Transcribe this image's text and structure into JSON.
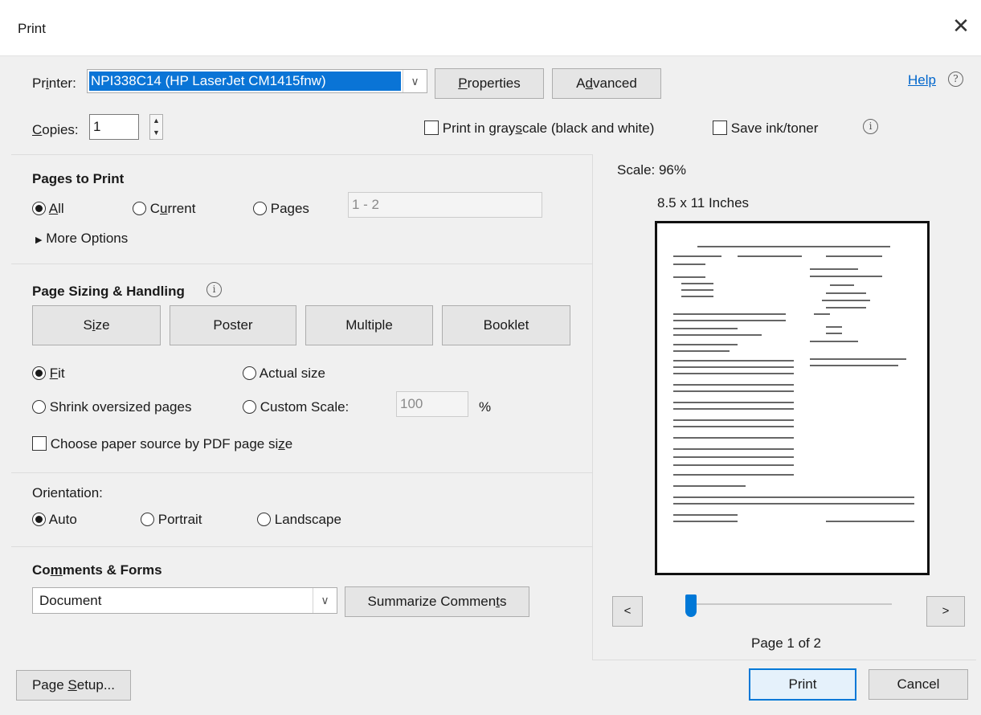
{
  "window": {
    "title": "Print"
  },
  "printer": {
    "label_pre": "Pr",
    "label_u": "i",
    "label_post": "nter:",
    "selected": "NPI338C14 (HP LaserJet CM1415fnw)",
    "properties_pre": "",
    "properties_u": "P",
    "properties_post": "roperties",
    "advanced_pre": "A",
    "advanced_u": "d",
    "advanced_post": "vanced",
    "help": "Help"
  },
  "copies": {
    "label_u": "C",
    "label_post": "opies:",
    "value": "1",
    "grayscale_pre": "Print in gray",
    "grayscale_u": "s",
    "grayscale_post": "cale (black and white)",
    "save_ink": "Save ink/toner"
  },
  "pages_to_print": {
    "title": "Pages to Print",
    "all_u": "A",
    "all_post": "ll",
    "current_pre": "C",
    "current_u": "u",
    "current_post": "rrent",
    "pages": "Pages",
    "range_value": "1 - 2",
    "more_options": "More Options"
  },
  "sizing": {
    "title": "Page Sizing & Handling",
    "size_pre": "S",
    "size_u": "i",
    "size_post": "ze",
    "poster": "Poster",
    "multiple": "Multiple",
    "booklet": "Booklet",
    "fit_u": "F",
    "fit_post": "it",
    "actual_size": "Actual size",
    "shrink": "Shrink oversized pages",
    "custom_scale": "Custom Scale:",
    "scale_value": "100",
    "percent": "%",
    "paper_source_pre": "Choose paper source by PDF page si",
    "paper_source_u": "z",
    "paper_source_post": "e"
  },
  "orientation": {
    "title": "Orientation:",
    "auto": "Auto",
    "portrait": "Portrait",
    "landscape": "Landscape"
  },
  "comments_forms": {
    "title_pre": "Co",
    "title_u": "m",
    "title_post": "ments & Forms",
    "selected": "Document",
    "summarize_pre": "Summarize Commen",
    "summarize_u": "t",
    "summarize_post": "s"
  },
  "preview": {
    "scale": "Scale: 96%",
    "paper": "8.5 x 11 Inches",
    "prev": "<",
    "next": ">",
    "page_indicator": "Page 1 of 2",
    "slider_fraction": 0
  },
  "footer": {
    "page_setup_pre": "Page ",
    "page_setup_u": "S",
    "page_setup_post": "etup...",
    "print": "Print",
    "cancel": "Cancel"
  },
  "colors": {
    "accent": "#0078d7",
    "selection": "#0a74d6",
    "link": "#0066cc"
  }
}
